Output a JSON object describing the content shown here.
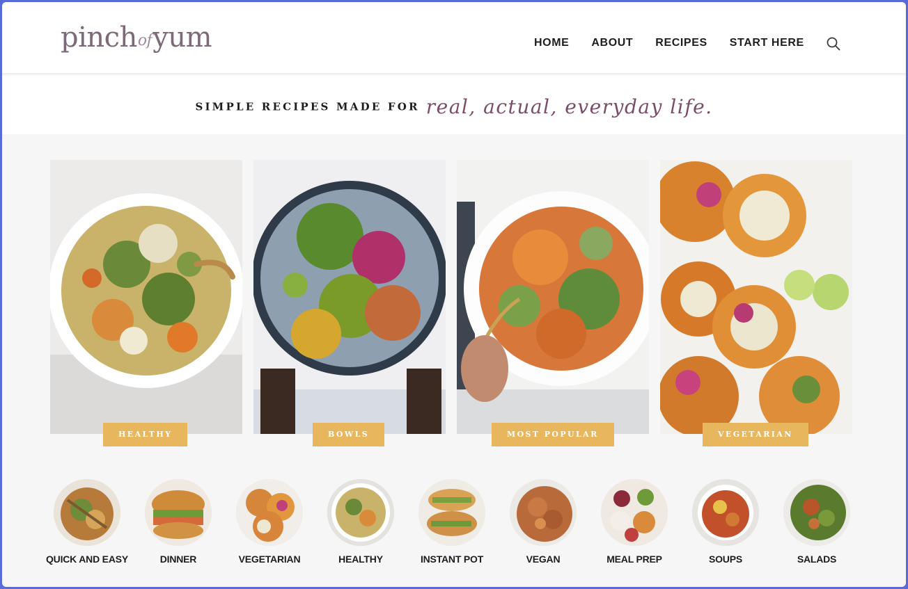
{
  "header": {
    "logo": {
      "part1": "pinch",
      "part2": "of",
      "part3": "yum"
    },
    "nav": [
      "HOME",
      "ABOUT",
      "RECIPES",
      "START HERE"
    ],
    "search_icon": "search-icon"
  },
  "tagline": {
    "plain": "SIMPLE RECIPES MADE FOR",
    "script": "real, actual, everyday life."
  },
  "features": [
    {
      "label": "HEALTHY",
      "image": "white-bean-soup-bowl"
    },
    {
      "label": "BOWLS",
      "image": "burrito-bowl"
    },
    {
      "label": "MOST POPULAR",
      "image": "quinoa-salad-bowl"
    },
    {
      "label": "VEGETARIAN",
      "image": "cauliflower-tostadas"
    }
  ],
  "categories": [
    {
      "label": "QUICK AND EASY"
    },
    {
      "label": "DINNER"
    },
    {
      "label": "VEGETARIAN"
    },
    {
      "label": "HEALTHY"
    },
    {
      "label": "INSTANT POT"
    },
    {
      "label": "VEGAN"
    },
    {
      "label": "MEAL PREP"
    },
    {
      "label": "SOUPS"
    },
    {
      "label": "SALADS"
    }
  ],
  "colors": {
    "accent": "#e8b65d",
    "logo": "#7d6a78",
    "script": "#7a4d6a",
    "frame": "#5a6ad6"
  }
}
